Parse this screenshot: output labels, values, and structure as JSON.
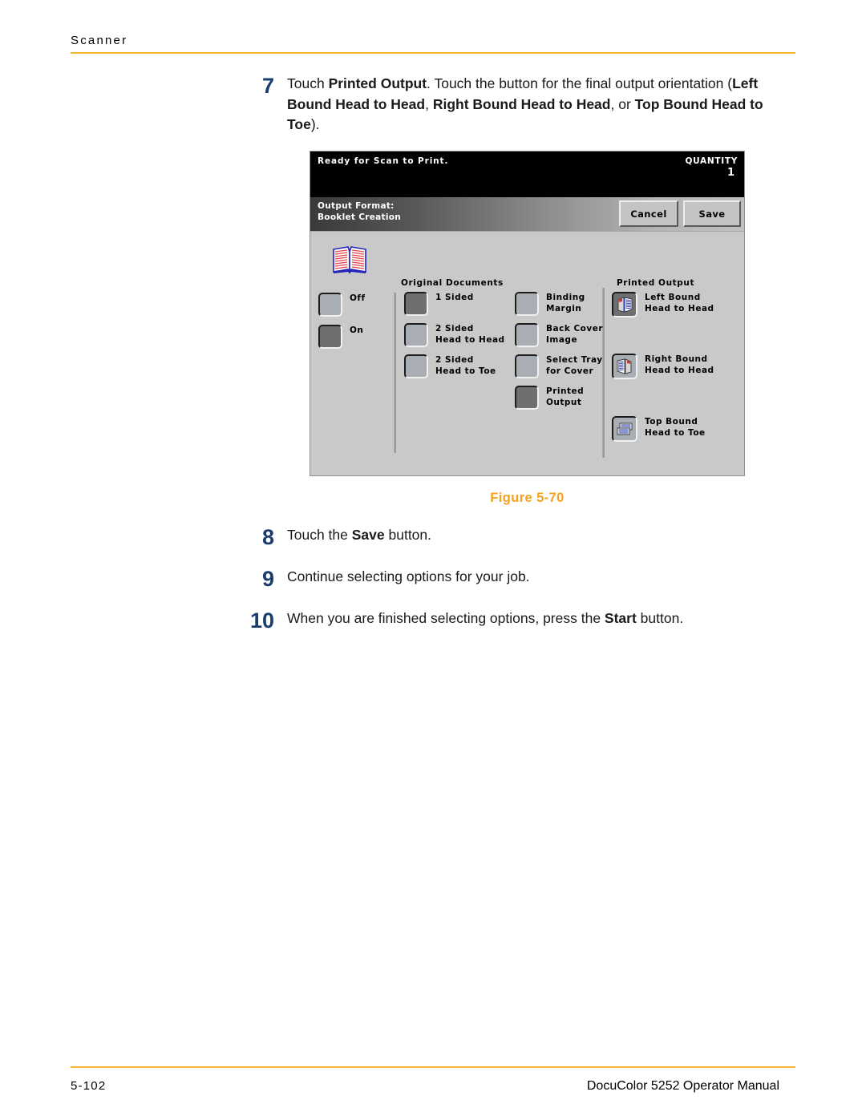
{
  "header": {
    "section_title": "Scanner"
  },
  "footer": {
    "page_number": "5-102",
    "manual_title": "DocuColor 5252 Operator Manual"
  },
  "figure": {
    "caption": "Figure 5-70"
  },
  "steps_upper": [
    {
      "number": "7",
      "parts": [
        {
          "text": "Touch ",
          "bold": false
        },
        {
          "text": "Printed Output",
          "bold": true
        },
        {
          "text": ". Touch the button for the final output orientation (",
          "bold": false
        },
        {
          "text": "Left Bound Head to Head",
          "bold": true
        },
        {
          "text": ", ",
          "bold": false
        },
        {
          "text": "Right Bound Head to Head",
          "bold": true
        },
        {
          "text": ", or ",
          "bold": false
        },
        {
          "text": "Top Bound Head to Toe",
          "bold": true
        },
        {
          "text": ").",
          "bold": false
        }
      ]
    }
  ],
  "steps_lower": [
    {
      "number": "8",
      "parts": [
        {
          "text": "Touch the ",
          "bold": false
        },
        {
          "text": "Save",
          "bold": true
        },
        {
          "text": " button.",
          "bold": false
        }
      ]
    },
    {
      "number": "9",
      "parts": [
        {
          "text": "Continue selecting options for your job.",
          "bold": false
        }
      ]
    },
    {
      "number": "10",
      "parts": [
        {
          "text": "When you are finished selecting options, press the ",
          "bold": false
        },
        {
          "text": "Start",
          "bold": true
        },
        {
          "text": " button.",
          "bold": false
        }
      ]
    }
  ],
  "scanner_ui": {
    "status_bar": {
      "message": "Ready  for  Scan  to  Print.",
      "quantity_label": "QUANTITY",
      "quantity_value": "1"
    },
    "title_bar": {
      "line1": "Output Format:",
      "line2": "Booklet Creation",
      "cancel_label": "Cancel",
      "save_label": "Save"
    },
    "booklet_toggle": [
      {
        "label": "Off",
        "selected": false
      },
      {
        "label": "On",
        "selected": true
      }
    ],
    "original_documents": {
      "title": "Original  Documents",
      "options": [
        {
          "line1": "1  Sided",
          "line2": "",
          "selected": true
        },
        {
          "line1": "2  Sided",
          "line2": "Head  to  Head",
          "selected": false
        },
        {
          "line1": "2  Sided",
          "line2": "Head  to  Toe",
          "selected": false
        }
      ]
    },
    "booklet_options": [
      {
        "line1": "Binding",
        "line2": "Margin",
        "selected": false
      },
      {
        "line1": "Back  Cover",
        "line2": "Image",
        "selected": false
      },
      {
        "line1": "Select  Tray",
        "line2": "for  Cover",
        "selected": false
      },
      {
        "line1": "Printed",
        "line2": "Output",
        "selected": true
      }
    ],
    "printed_output": {
      "title": "Printed  Output",
      "options": [
        {
          "line1": "Left  Bound",
          "line2": "Head  to  Head",
          "icon": "left-bound-icon",
          "selected": true
        },
        {
          "line1": "Right  Bound",
          "line2": "Head  to  Head",
          "icon": "right-bound-icon",
          "selected": false
        },
        {
          "line1": "Top  Bound",
          "line2": "Head  to  Toe",
          "icon": "top-bound-icon",
          "selected": false
        }
      ]
    },
    "colors": {
      "panel_bg": "#c9c9c9",
      "status_bg": "#000000",
      "button_face": "#a9aeb5",
      "button_selected": "#6f6f6f"
    }
  },
  "accent_color": "#f5b335",
  "step_number_color": "#1b3e6f"
}
